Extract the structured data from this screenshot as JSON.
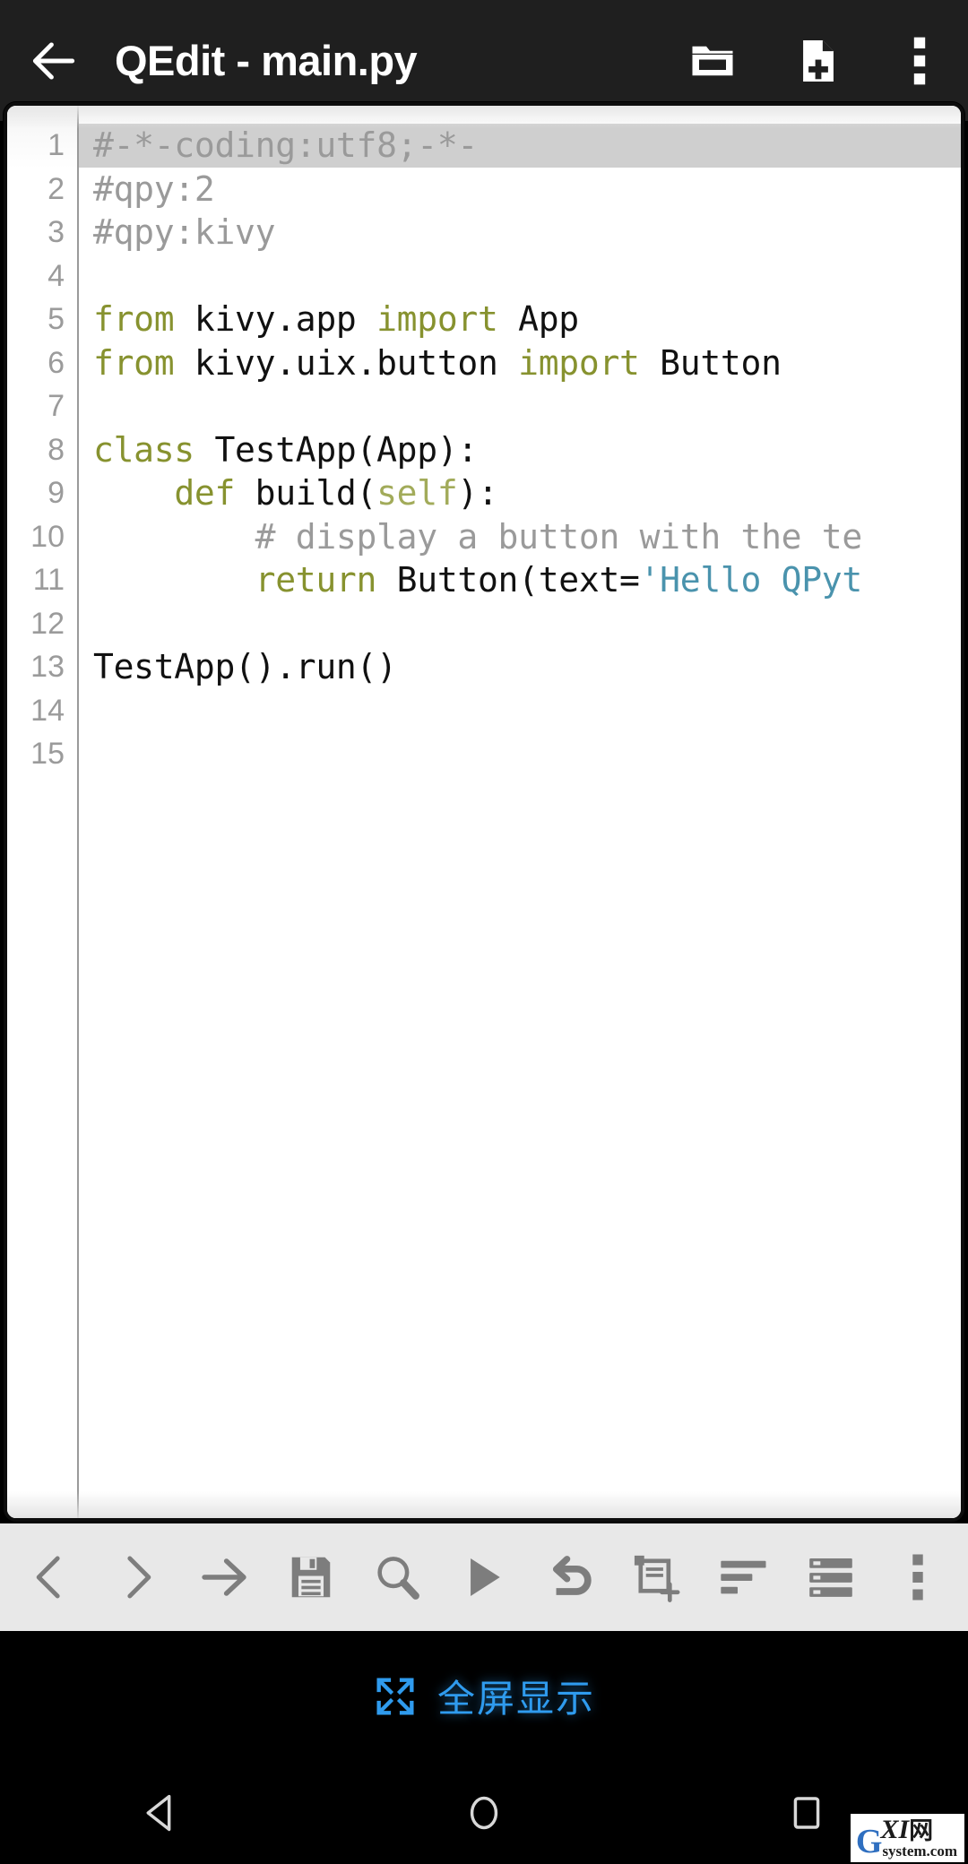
{
  "appbar": {
    "back_icon": "arrow-left-icon",
    "title": "QEdit - main.py",
    "actions": [
      {
        "icon": "folder-open-icon",
        "label": "Open"
      },
      {
        "icon": "file-new-icon",
        "label": "New file"
      },
      {
        "icon": "overflow-menu-icon",
        "label": "More options"
      }
    ]
  },
  "editor": {
    "line_numbers": [
      "1",
      "2",
      "3",
      "4",
      "5",
      "6",
      "7",
      "8",
      "9",
      "10",
      "11",
      "12",
      "13",
      "14",
      "15"
    ],
    "current_line": 1,
    "colors": {
      "keyword": "#87922f",
      "comment": "#9a9a9a",
      "string": "#4a93ad",
      "text": "#111111",
      "current_line_bg": "#cfcfcf",
      "gutter_text": "#9b9b9b",
      "background": "#ffffff"
    },
    "lines": [
      {
        "n": 1,
        "tokens": [
          {
            "t": "#-*-coding:utf8;-*-",
            "c": "cmt"
          }
        ]
      },
      {
        "n": 2,
        "tokens": [
          {
            "t": "#qpy:2",
            "c": "cmt"
          }
        ]
      },
      {
        "n": 3,
        "tokens": [
          {
            "t": "#qpy:kivy",
            "c": "cmt"
          }
        ]
      },
      {
        "n": 4,
        "tokens": []
      },
      {
        "n": 5,
        "tokens": [
          {
            "t": "from",
            "c": "kw"
          },
          {
            "t": " kivy.app ",
            "c": ""
          },
          {
            "t": "import",
            "c": "kw"
          },
          {
            "t": " App",
            "c": ""
          }
        ]
      },
      {
        "n": 6,
        "tokens": [
          {
            "t": "from",
            "c": "kw"
          },
          {
            "t": " kivy.uix.button ",
            "c": ""
          },
          {
            "t": "import",
            "c": "kw"
          },
          {
            "t": " Button",
            "c": ""
          }
        ]
      },
      {
        "n": 7,
        "tokens": []
      },
      {
        "n": 8,
        "tokens": [
          {
            "t": "class",
            "c": "kw"
          },
          {
            "t": " TestApp(App):",
            "c": ""
          }
        ]
      },
      {
        "n": 9,
        "tokens": [
          {
            "t": "    ",
            "c": ""
          },
          {
            "t": "def",
            "c": "kw"
          },
          {
            "t": " build(",
            "c": ""
          },
          {
            "t": "self",
            "c": "self"
          },
          {
            "t": "):",
            "c": ""
          }
        ]
      },
      {
        "n": 10,
        "tokens": [
          {
            "t": "        # display a button with the te",
            "c": "cmt"
          }
        ]
      },
      {
        "n": 11,
        "tokens": [
          {
            "t": "        ",
            "c": ""
          },
          {
            "t": "return",
            "c": "kw"
          },
          {
            "t": " Button(text=",
            "c": ""
          },
          {
            "t": "'Hello QPyt",
            "c": "str"
          }
        ]
      },
      {
        "n": 12,
        "tokens": []
      },
      {
        "n": 13,
        "tokens": [
          {
            "t": "TestApp().run()",
            "c": ""
          }
        ]
      },
      {
        "n": 14,
        "tokens": []
      },
      {
        "n": 15,
        "tokens": []
      }
    ]
  },
  "toolbar": {
    "buttons": [
      {
        "icon": "chevron-left-icon",
        "label": "Previous"
      },
      {
        "icon": "chevron-right-icon",
        "label": "Next"
      },
      {
        "icon": "arrow-right-icon",
        "label": "Indent"
      },
      {
        "icon": "save-floppy-icon",
        "label": "Save"
      },
      {
        "icon": "search-icon",
        "label": "Search"
      },
      {
        "icon": "play-run-icon",
        "label": "Run"
      },
      {
        "icon": "undo-icon",
        "label": "Undo"
      },
      {
        "icon": "duplicate-add-icon",
        "label": "New tab"
      },
      {
        "icon": "align-left-icon",
        "label": "Format"
      },
      {
        "icon": "list-rows-icon",
        "label": "List"
      },
      {
        "icon": "overflow-menu-icon",
        "label": "More"
      }
    ]
  },
  "fullscreen": {
    "icon": "expand-fullscreen-icon",
    "label": "全屏显示",
    "color": "#2f9bee"
  },
  "navbar": {
    "buttons": [
      {
        "icon": "android-back-icon",
        "label": "Back"
      },
      {
        "icon": "android-home-icon",
        "label": "Home"
      },
      {
        "icon": "android-recents-icon",
        "label": "Recents"
      }
    ]
  },
  "watermark": {
    "g": "G",
    "xi": "XI",
    "cn": "网",
    "sub": "system.com"
  }
}
